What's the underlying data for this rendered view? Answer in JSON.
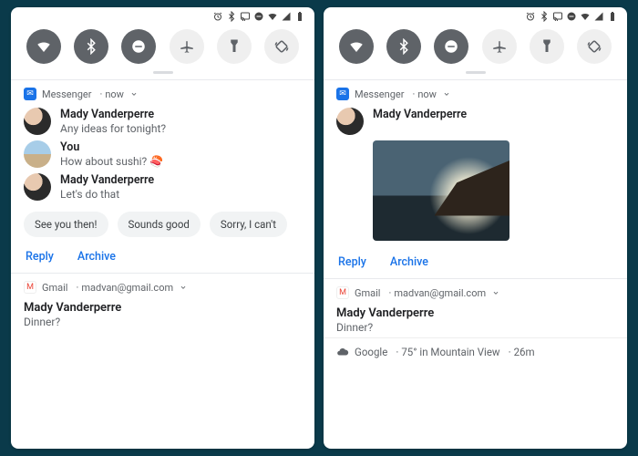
{
  "status_icons": [
    "alarm-icon",
    "bluetooth-icon",
    "cast-icon",
    "dnd-icon",
    "wifi-icon",
    "signal-icon",
    "battery-icon"
  ],
  "quick_settings": [
    {
      "name": "wifi",
      "on": true
    },
    {
      "name": "bluetooth",
      "on": true
    },
    {
      "name": "dnd",
      "on": true
    },
    {
      "name": "airplane",
      "on": false
    },
    {
      "name": "flashlight",
      "on": false
    },
    {
      "name": "rotate",
      "on": false
    }
  ],
  "left": {
    "messenger": {
      "app": "Messenger",
      "time": "now",
      "thread": [
        {
          "name": "Mady Vanderperre",
          "body": "Any ideas for tonight?",
          "avatar": "av1"
        },
        {
          "name": "You",
          "body": "How about sushi? 🍣",
          "avatar": "av2"
        },
        {
          "name": "Mady Vanderperre",
          "body": "Let's do that",
          "avatar": "av1"
        }
      ],
      "chips": [
        "See you then!",
        "Sounds good",
        "Sorry, I can't"
      ],
      "actions": {
        "reply": "Reply",
        "archive": "Archive"
      }
    },
    "gmail": {
      "app": "Gmail",
      "account": "madvan@gmail.com",
      "sender": "Mady Vanderperre",
      "subject": "Dinner?"
    }
  },
  "right": {
    "messenger": {
      "app": "Messenger",
      "time": "now",
      "sender": "Mady Vanderperre",
      "actions": {
        "reply": "Reply",
        "archive": "Archive"
      }
    },
    "gmail": {
      "app": "Gmail",
      "account": "madvan@gmail.com",
      "sender": "Mady Vanderperre",
      "subject": "Dinner?"
    },
    "weather": {
      "provider": "Google",
      "summary": "75° in Mountain View",
      "age": "26m"
    }
  }
}
